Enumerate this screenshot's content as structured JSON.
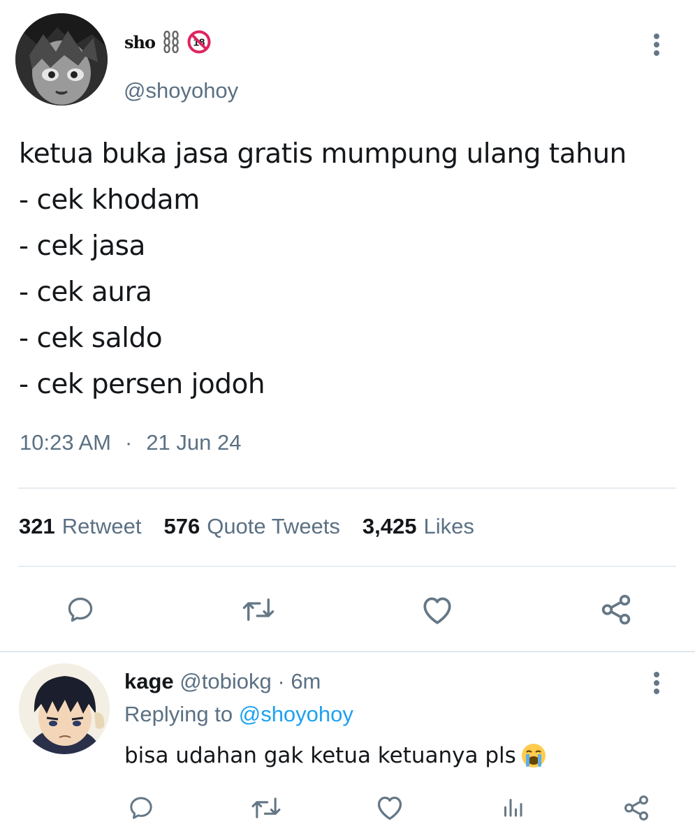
{
  "tweet": {
    "display_name": "sho",
    "name_emoji": [
      "chains-emoji",
      "no-one-under-eighteen-emoji"
    ],
    "name_badge": "18",
    "handle": "@shoyohoy",
    "text_lines": [
      "ketua buka jasa gratis mumpung ulang tahun",
      "- cek khodam",
      "- cek jasa",
      "- cek aura",
      "- cek saldo",
      "- cek persen jodoh"
    ],
    "time": "10:23 AM",
    "separator": "·",
    "date": "21 Jun 24",
    "stats": {
      "retweets_count": "321",
      "retweets_label": "Retweet",
      "quotes_count": "576",
      "quotes_label": "Quote Tweets",
      "likes_count": "3,425",
      "likes_label": "Likes"
    },
    "actions": [
      "reply-icon",
      "retweet-icon",
      "like-icon",
      "share-icon"
    ]
  },
  "reply": {
    "display_name": "kage",
    "handle": "@tobiokg",
    "separator": "·",
    "time": "6m",
    "replying_label": "Replying to",
    "replying_to": "@shoyohoy",
    "text": "bisa udahan gak ketua ketuanya pls",
    "emoji": "loudly-crying-face-emoji",
    "actions": [
      "reply-icon",
      "retweet-icon",
      "like-icon",
      "analytics-icon",
      "share-icon"
    ]
  },
  "colors": {
    "text_primary": "#14171a",
    "text_secondary": "#5b7083",
    "link": "#1da1f2",
    "icon": "#657786",
    "divider": "#e6ecf0",
    "badge_red": "#e0245e"
  }
}
